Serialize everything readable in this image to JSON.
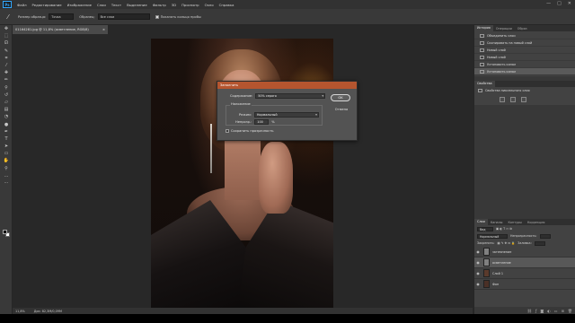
{
  "menubar": {
    "logo": "Ps",
    "items": [
      "Файл",
      "Редактирование",
      "Изображение",
      "Слои",
      "Текст",
      "Выделение",
      "Фильтр",
      "3D",
      "Просмотр",
      "Окно",
      "Справка"
    ],
    "window_controls": [
      "—",
      "□",
      "✕"
    ]
  },
  "options": {
    "tool_icon": "eyedropper-icon",
    "size_label": "Размер образца:",
    "size_value": "Точка",
    "sample_label": "Образец:",
    "sample_value": "Все слои",
    "show_ring_label": "Показать кольцо пробы"
  },
  "document": {
    "tab_title": "01164281.jpg @ 11,8% (осветление, RGB/8)",
    "close": "×",
    "zoom": "11,8%",
    "doc_info": "Док: 82,3M/0,09M"
  },
  "dialog": {
    "title": "Заполнить",
    "content_label": "Содержание:",
    "content_value": "50% серого",
    "blending_legend": "Наложение",
    "mode_label": "Режим:",
    "mode_value": "Нормальный",
    "opacity_label": "Непрозр.:",
    "opacity_value": "100",
    "opacity_unit": "%",
    "preserve_label": "Сохранить прозрачность",
    "ok_label": "OK",
    "cancel_label": "Отмена"
  },
  "history_panel": {
    "tabs": [
      "История",
      "Операции",
      "Образ"
    ],
    "items": [
      "Объединить слои",
      "Скопировать на новый слой",
      "Новый слой",
      "Новый слой",
      "Установить канал",
      "Установить канал"
    ],
    "active_index": 5
  },
  "properties_panel": {
    "tab": "Свойства",
    "row": "Свойства пиксельного слоя"
  },
  "layers_panel": {
    "tabs": [
      "Слои",
      "Каналы",
      "Контуры",
      "Коррекция"
    ],
    "kind_label": "Вид",
    "blend_mode": "Нормальный",
    "opacity_label": "Непрозрачность:",
    "fill_label": "Заливка:",
    "lock_label": "Закрепить:",
    "layers": [
      {
        "name": "затемнение",
        "thumb_color": "#808080"
      },
      {
        "name": "осветление",
        "thumb_color": "#808080"
      },
      {
        "name": "Слой 1",
        "thumb_color": "#5a3a2c"
      },
      {
        "name": "Фон",
        "thumb_color": "#4a3026"
      }
    ],
    "active_index": 1
  }
}
